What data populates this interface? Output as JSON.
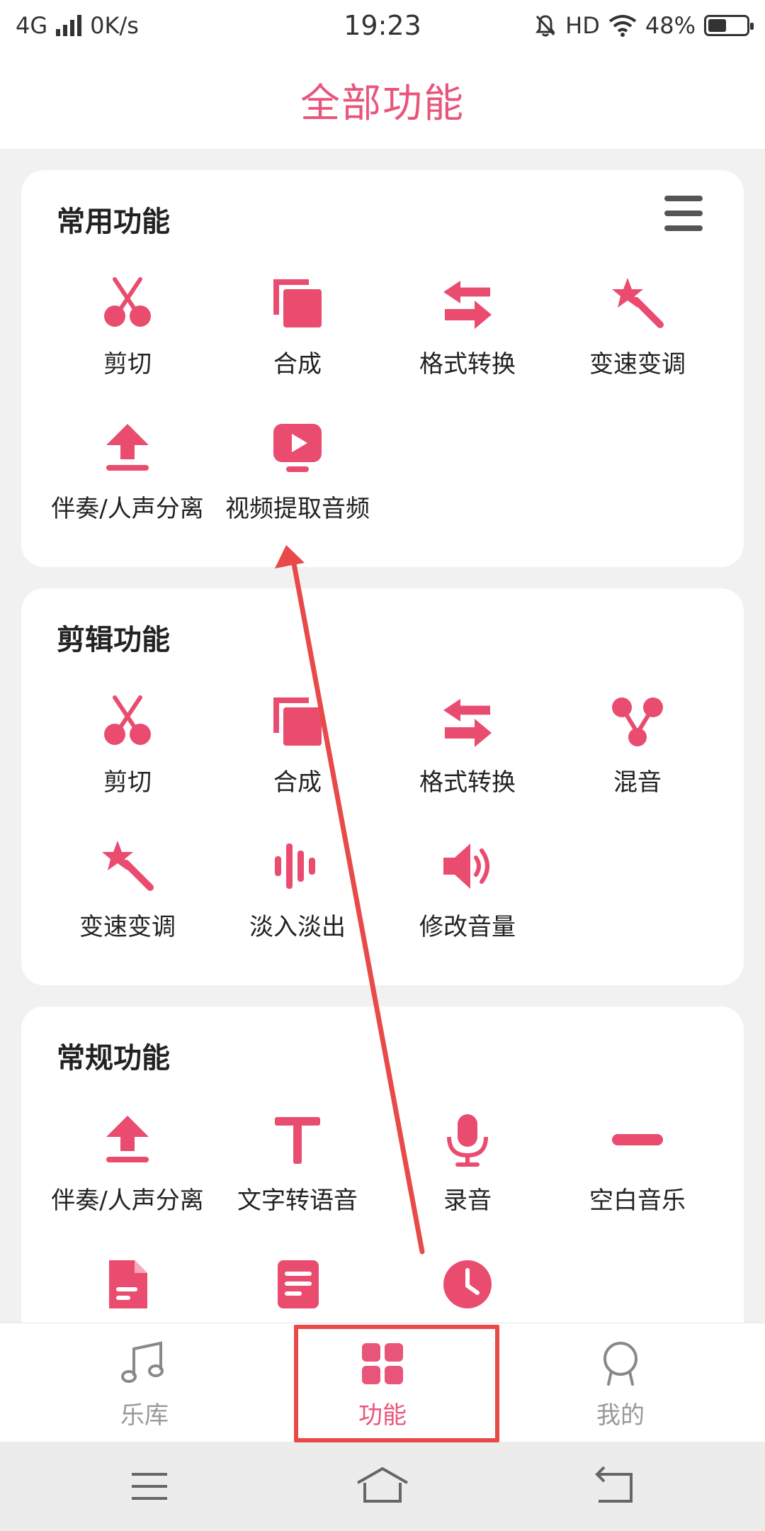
{
  "status_bar": {
    "network": "4G",
    "speed": "0K/s",
    "time": "19:23",
    "hd": "HD",
    "battery_percent": "48%",
    "battery_level": 0.48
  },
  "header": {
    "title": "全部功能"
  },
  "sections": {
    "common": {
      "title": "常用功能",
      "items": [
        {
          "label": "剪切",
          "icon": "scissors-icon"
        },
        {
          "label": "合成",
          "icon": "merge-icon"
        },
        {
          "label": "格式转换",
          "icon": "convert-arrows-icon"
        },
        {
          "label": "变速变调",
          "icon": "magic-wand-icon"
        },
        {
          "label": "伴奏/人声分离",
          "icon": "upload-icon"
        },
        {
          "label": "视频提取音频",
          "icon": "video-play-icon"
        }
      ]
    },
    "edit": {
      "title": "剪辑功能",
      "items": [
        {
          "label": "剪切",
          "icon": "scissors-icon"
        },
        {
          "label": "合成",
          "icon": "merge-icon"
        },
        {
          "label": "格式转换",
          "icon": "convert-arrows-icon"
        },
        {
          "label": "混音",
          "icon": "mix-icon"
        },
        {
          "label": "变速变调",
          "icon": "magic-wand-icon"
        },
        {
          "label": "淡入淡出",
          "icon": "waveform-icon"
        },
        {
          "label": "修改音量",
          "icon": "volume-icon"
        }
      ]
    },
    "general": {
      "title": "常规功能",
      "items": [
        {
          "label": "伴奏/人声分离",
          "icon": "upload-icon"
        },
        {
          "label": "文字转语音",
          "icon": "text-t-icon"
        },
        {
          "label": "录音",
          "icon": "microphone-icon"
        },
        {
          "label": "空白音乐",
          "icon": "minus-bar-icon"
        },
        {
          "label": "",
          "icon": "document-icon"
        },
        {
          "label": "",
          "icon": "list-document-icon"
        },
        {
          "label": "",
          "icon": "clock-icon"
        }
      ]
    }
  },
  "bottom_nav": {
    "items": [
      {
        "label": "乐库",
        "icon": "music-note-icon"
      },
      {
        "label": "功能",
        "icon": "grid-apps-icon",
        "active": true
      },
      {
        "label": "我的",
        "icon": "profile-badge-icon"
      }
    ]
  },
  "colors": {
    "accent": "#e9557a",
    "icon": "#ea4c70",
    "annotation": "#e84a4a"
  }
}
